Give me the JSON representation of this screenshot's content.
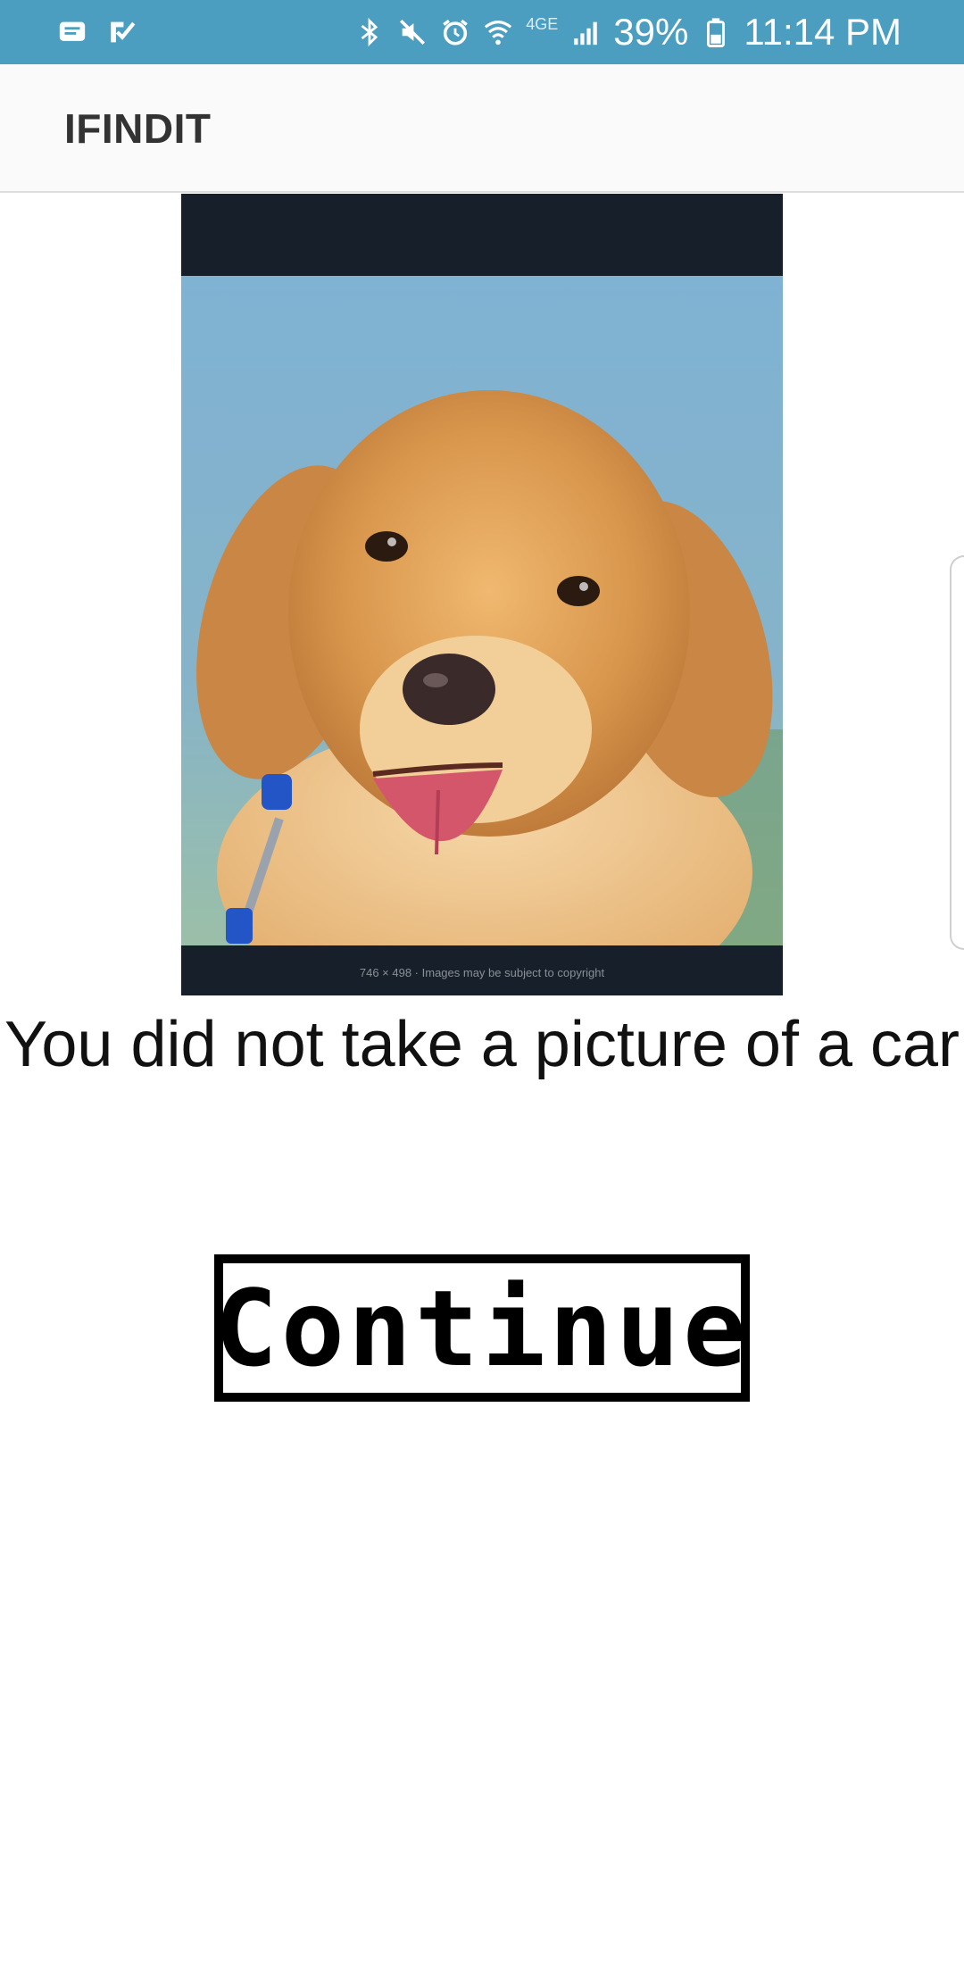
{
  "status_bar": {
    "network": "4GE",
    "battery": "39%",
    "time": "11:14 PM",
    "icons": [
      "message-icon",
      "check-icon",
      "bluetooth-icon",
      "mute-icon",
      "alarm-icon",
      "wifi-icon",
      "signal-icon",
      "battery-icon"
    ]
  },
  "app_bar": {
    "title": "IFINDIT"
  },
  "photo": {
    "caption": "746 × 498 · Images may be subject to copyright"
  },
  "result": {
    "message": "You did not take a picture of a car"
  },
  "actions": {
    "continue_label": "Continue"
  },
  "colors": {
    "status_bar": "#4c9ec0",
    "app_bar": "#fafafa",
    "accent_text": "#333333"
  }
}
